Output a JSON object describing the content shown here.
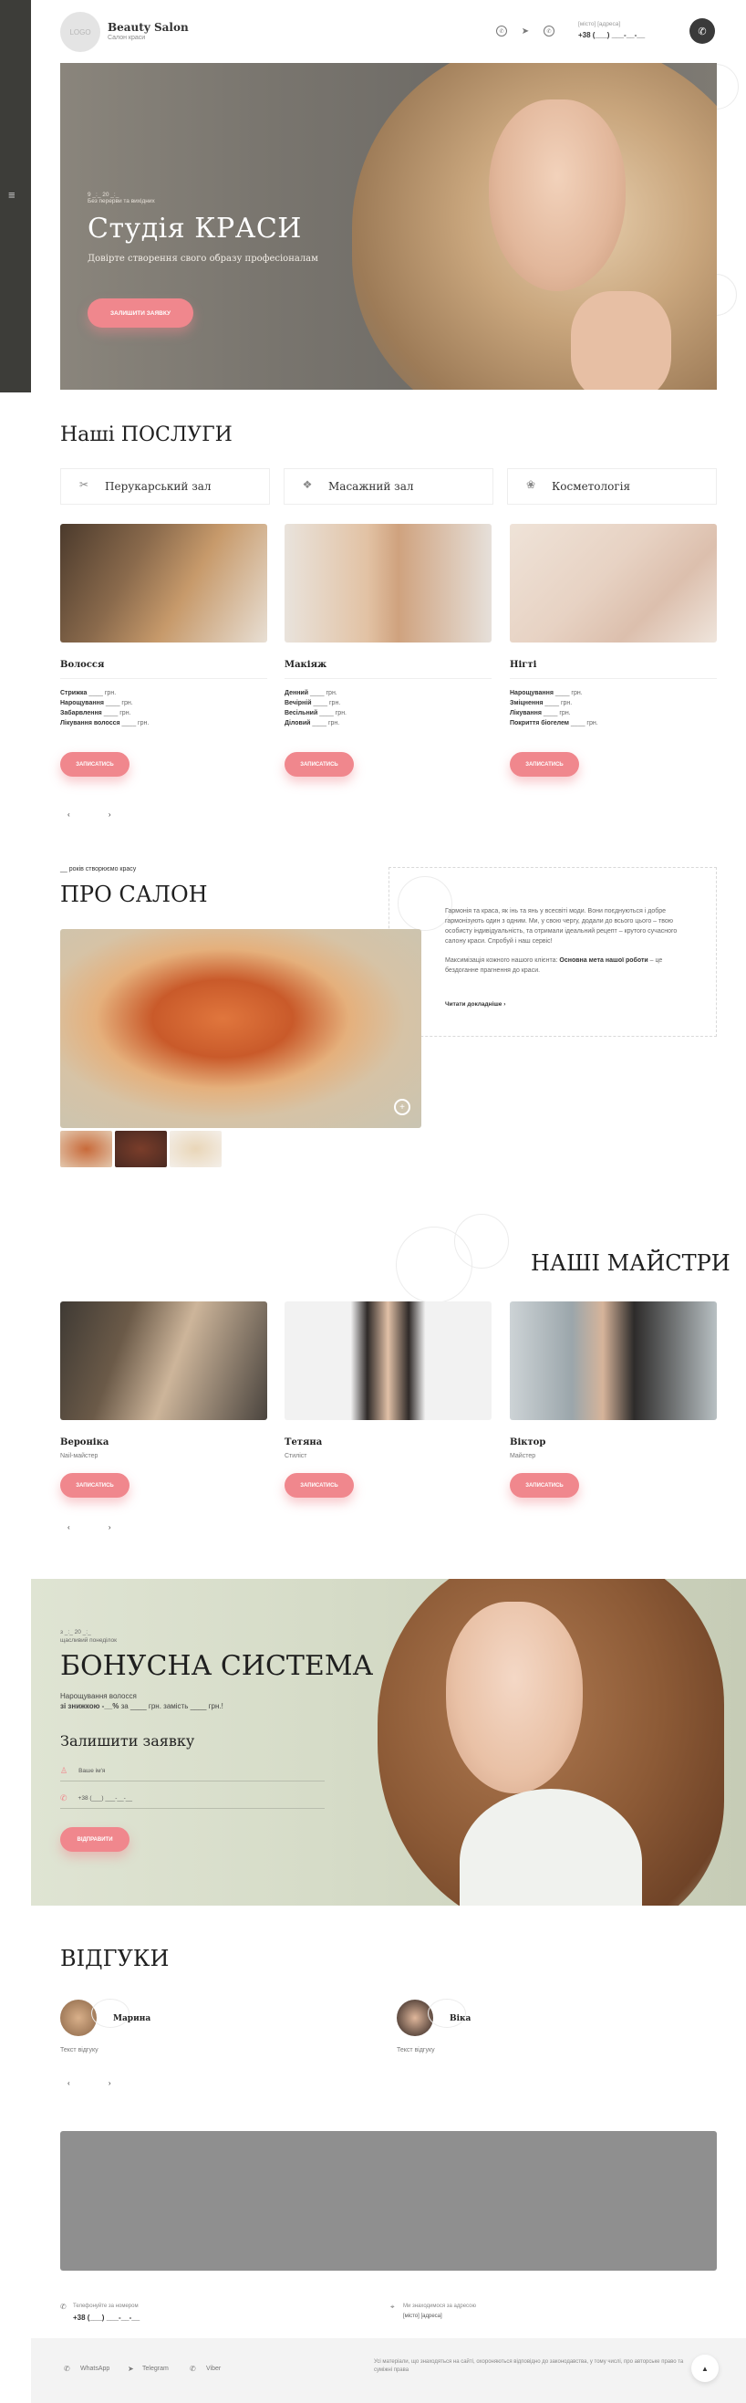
{
  "header": {
    "logo": "LOGO",
    "brand_name": "Beauty Salon",
    "brand_sub": "Салон краси",
    "address": "[місто] [адреса]",
    "phone": "+38 (___) ___-__-__"
  },
  "hero": {
    "eyebrow": "9 _:_ 20 _:_",
    "eyebrow2": "Без перерви та вихідних",
    "title": "Студія КРАСИ",
    "subtitle": "Довірте створення свого образу професіоналам",
    "button": "ЗАЛИШИТИ ЗАЯВКУ"
  },
  "services": {
    "title": "Наші ПОСЛУГИ",
    "tabs": [
      "Перукарський зал",
      "Масажний зал",
      "Косметологія"
    ],
    "cards": [
      {
        "name": "Волосся",
        "rows": [
          {
            "label": "Стрижка",
            "rest": " ____ грн."
          },
          {
            "label": "Нарощування",
            "rest": " ____ грн."
          },
          {
            "label": "Забарвлення",
            "rest": " ____ грн."
          },
          {
            "label": "Лікування волосся",
            "rest": " ____ грн."
          }
        ],
        "button": "ЗАПИСАТИСЬ"
      },
      {
        "name": "Макіяж",
        "rows": [
          {
            "label": "Денний",
            "rest": " ____ грн."
          },
          {
            "label": "Вечірній",
            "rest": " ____ грн."
          },
          {
            "label": "Весільний",
            "rest": " ____ грн."
          },
          {
            "label": "Діловий",
            "rest": " ____ грн."
          }
        ],
        "button": "ЗАПИСАТИСЬ"
      },
      {
        "name": "Нігті",
        "rows": [
          {
            "label": "Нарощування",
            "rest": " ____ грн."
          },
          {
            "label": "Зміцнення",
            "rest": " ____ грн."
          },
          {
            "label": "Лікування",
            "rest": " ____ грн."
          },
          {
            "label": "Покриття біогелем",
            "rest": " ____ грн."
          }
        ],
        "button": "ЗАПИСАТИСЬ"
      }
    ],
    "arrows": "‹ ›"
  },
  "about": {
    "eyebrow": "__ років створюємо красу",
    "title": "ПРО САЛОН",
    "p1": "Гармонія та краса, як інь та янь у всесвіті моди. Вони поєднуються і добре гармонізують один з одним. Ми, у свою чергу, додали до всього цього – твою особисту індивідуальність, та отримали ідеальний рецепт – крутого сучасного салону краси. Спробуй і наш сервіс!",
    "p2_a": "Максимізація кожного нашого клієнта: ",
    "p2_b": "Основна мета нашої роботи",
    "p2_c": " – це бездоганне прагнення до краси.",
    "more": "Читати докладніше"
  },
  "masters": {
    "title": "НАШІ МАЙСТРИ",
    "cards": [
      {
        "name": "Вероніка",
        "role": "Nail-майстер",
        "button": "ЗАПИСАТИСЬ"
      },
      {
        "name": "Тетяна",
        "role": "Стиліст",
        "button": "ЗАПИСАТИСЬ"
      },
      {
        "name": "Віктор",
        "role": "Майстер",
        "button": "ЗАПИСАТИСЬ"
      }
    ],
    "arrows": "‹ ›"
  },
  "bonus": {
    "eyebrow": "з _:_ 20 _:_",
    "eyebrow2": "щасливий понеділок",
    "title": "БОНУСНА СИСТЕМА",
    "line1": "Нарощування волосся",
    "line2_a": "зі знижкою -__% ",
    "line2_b": "за ____ грн. замість ____ грн.!",
    "form_title": "Залишити заявку",
    "name_placeholder": "Ваше ім'я",
    "phone_placeholder": "+38 (___) ___-__-__",
    "button": "ВІДПРАВИТИ"
  },
  "reviews": {
    "title": "ВІДГУКИ",
    "items": [
      {
        "name": "Марина",
        "text": "Текст відгуку"
      },
      {
        "name": "Віка",
        "text": "Текст відгуку"
      }
    ],
    "arrows": "‹ ›"
  },
  "contacts": {
    "phone_label": "Телефонуйте за номером",
    "phone": "+38 (___) ___-__-__",
    "address_label": "Ми знаходимося за адресою",
    "address": "[місто] [адреса]"
  },
  "footer": {
    "links": [
      "WhatsApp",
      "Telegram",
      "Viber"
    ],
    "copyright": "Усі матеріали, що знаходяться на сайті, охороняються відповідно до законодавства, у тому числі, про авторське право та суміжні права"
  },
  "colors": {
    "accent": "#f0878d",
    "dark": "#3a3a3a"
  }
}
